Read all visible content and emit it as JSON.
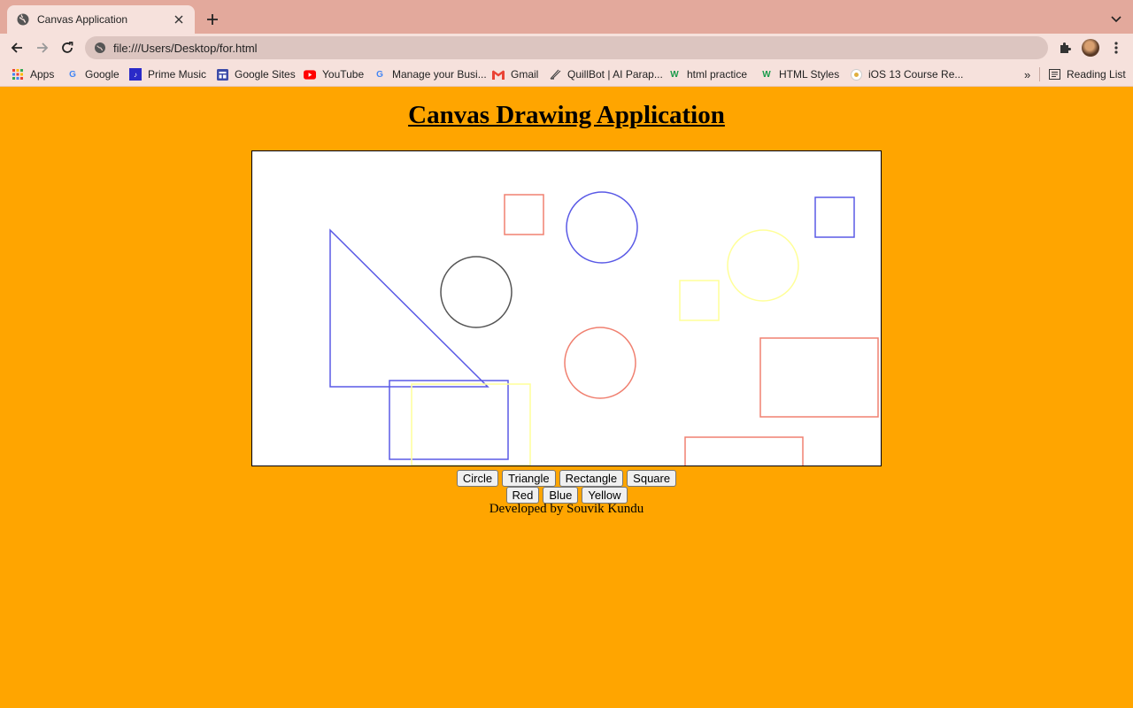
{
  "browser": {
    "tab_title": "Canvas Application",
    "url": "file:///Users/Desktop/for.html",
    "bookmarks": [
      {
        "label": "Apps",
        "icon": "apps-grid-icon"
      },
      {
        "label": "Google",
        "icon": "google-icon"
      },
      {
        "label": "Prime Music",
        "icon": "prime-music-icon"
      },
      {
        "label": "Google Sites",
        "icon": "google-sites-icon"
      },
      {
        "label": "YouTube",
        "icon": "youtube-icon"
      },
      {
        "label": "Manage your Busi...",
        "icon": "google-icon"
      },
      {
        "label": "Gmail",
        "icon": "gmail-icon"
      },
      {
        "label": "QuillBot | AI Parap...",
        "icon": "quillbot-icon"
      },
      {
        "label": "html practice",
        "icon": "w3schools-icon"
      },
      {
        "label": "HTML Styles",
        "icon": "w3schools-icon"
      },
      {
        "label": "iOS 13 Course Re...",
        "icon": "course-icon"
      }
    ],
    "overflow_label": "»",
    "reading_list_label": "Reading List"
  },
  "page": {
    "heading": "Canvas Drawing Application",
    "shape_buttons": [
      "Circle",
      "Triangle",
      "Rectangle",
      "Square"
    ],
    "color_buttons": [
      "Red",
      "Blue",
      "Yellow"
    ],
    "footer": "Developed by Souvik Kundu"
  },
  "colors": {
    "page_background": "#ffa500",
    "red": "#f08070",
    "blue": "#5a5ae6",
    "yellow": "#ffff99",
    "gray": "#555555"
  },
  "canvas_shapes": [
    {
      "type": "triangle",
      "color": "blue"
    },
    {
      "type": "square",
      "color": "red"
    },
    {
      "type": "circle",
      "color": "blue"
    },
    {
      "type": "square",
      "color": "blue"
    },
    {
      "type": "circle",
      "color": "yellow"
    },
    {
      "type": "circle",
      "color": "gray"
    },
    {
      "type": "square",
      "color": "yellow"
    },
    {
      "type": "circle",
      "color": "red"
    },
    {
      "type": "rectangle",
      "color": "red"
    },
    {
      "type": "rectangle",
      "color": "blue"
    },
    {
      "type": "rectangle",
      "color": "yellow"
    },
    {
      "type": "rectangle",
      "color": "red"
    }
  ]
}
